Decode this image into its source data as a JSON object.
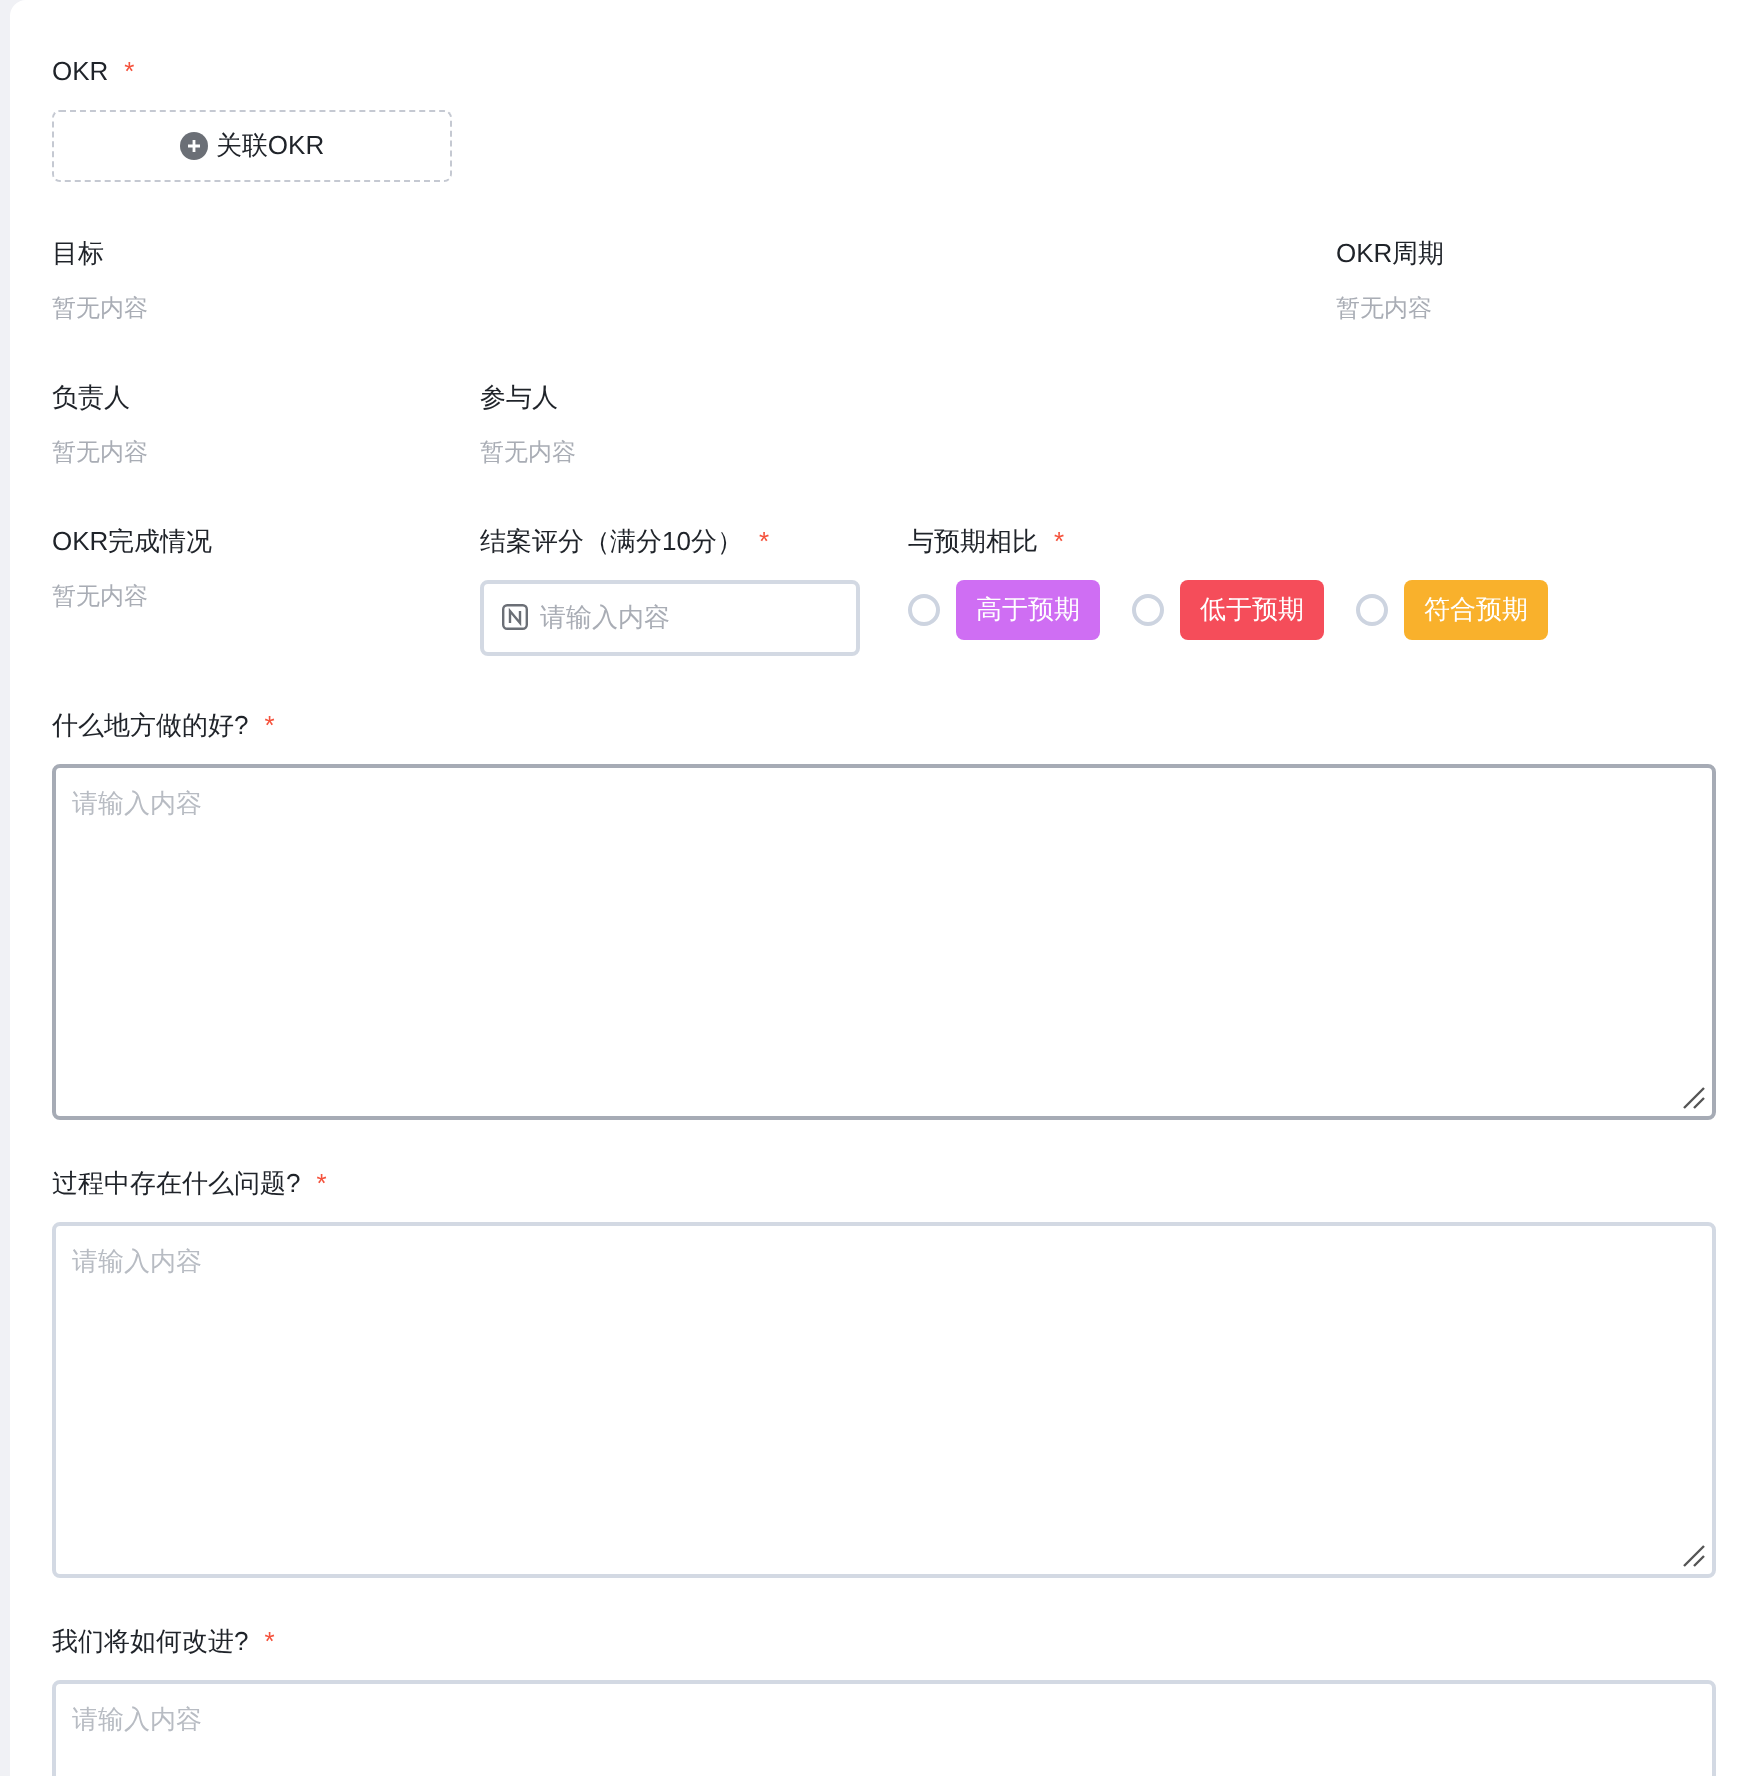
{
  "okr": {
    "label": "OKR",
    "required_mark": "*",
    "button": "关联OKR"
  },
  "info_rows": [
    [
      {
        "label": "目标",
        "value": "暂无内容"
      },
      {
        "label": "OKR周期",
        "value": "暂无内容"
      }
    ],
    [
      {
        "label": "负责人",
        "value": "暂无内容"
      },
      {
        "label": "参与人",
        "value": "暂无内容"
      }
    ]
  ],
  "completion": {
    "label": "OKR完成情况",
    "value": "暂无内容"
  },
  "score": {
    "label": "结案评分（满分10分）",
    "required_mark": "*",
    "placeholder": "请输入内容"
  },
  "comparison": {
    "label": "与预期相比",
    "required_mark": "*",
    "options": [
      {
        "label": "高于预期",
        "color": "#cf6ef3",
        "selected": false
      },
      {
        "label": "低于预期",
        "color": "#f54d5a",
        "selected": false
      },
      {
        "label": "符合预期",
        "color": "#f9b12c",
        "selected": false
      }
    ]
  },
  "questions": [
    {
      "label": "什么地方做的好?",
      "required_mark": "*",
      "placeholder": "请输入内容",
      "focused": true
    },
    {
      "label": "过程中存在什么问题?",
      "required_mark": "*",
      "placeholder": "请输入内容",
      "focused": false
    },
    {
      "label": "我们将如何改进?",
      "required_mark": "*",
      "placeholder": "请输入内容",
      "focused": false
    }
  ]
}
